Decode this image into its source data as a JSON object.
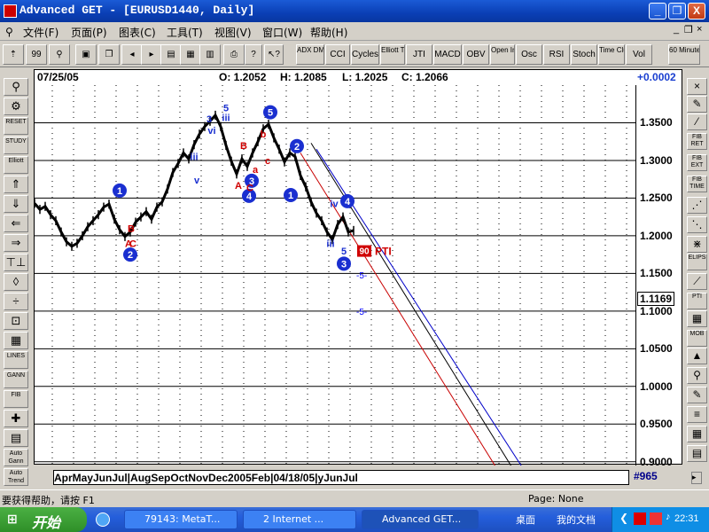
{
  "window": {
    "title": "Advanced GET - [EURUSD1440, Daily]",
    "buttons": [
      "_",
      "❐",
      "X"
    ]
  },
  "menu": [
    "文件(F)",
    "页面(P)",
    "图表(C)",
    "工具(T)",
    "视图(V)",
    "窗口(W)",
    "帮助(H)"
  ],
  "toolbar": {
    "indicators": [
      "ADX DMI",
      "CCI",
      "Cycles",
      "Elliott Trig",
      "JTI",
      "MACD",
      "OBV",
      "Open Int",
      "Osc",
      "RSI",
      "Stoch",
      "Time Clust",
      "Vol",
      "60 Minute"
    ]
  },
  "left_tools": [
    "",
    "",
    "RESET",
    "STUDY",
    "Elliott",
    "",
    "",
    "",
    "",
    "",
    "",
    "",
    "",
    "",
    "LINES",
    "GANN",
    "FIB",
    "",
    "",
    "Auto Gann",
    "Auto Trend"
  ],
  "right_tools": [
    "",
    "",
    "",
    "FIB RET",
    "FIB EXT",
    "FIB TIME",
    "",
    "",
    "",
    "ELIPS",
    "",
    "PTI",
    "",
    "MOB",
    "",
    "",
    "",
    "",
    "",
    ""
  ],
  "infobar": {
    "date": "07/25/05",
    "open": "O: 1.2052",
    "high": "H: 1.2085",
    "low": "L: 1.2025",
    "close": "C: 1.2066",
    "change": "+0.0002"
  },
  "price_axis": {
    "ticks": [
      "1.3500",
      "1.3000",
      "1.2500",
      "1.2000",
      "1.1500",
      "1.1169",
      "1.1000",
      "1.0500",
      "1.0000",
      "0.9500",
      "0.9000"
    ],
    "current": "1.1169"
  },
  "chart_data": {
    "type": "line",
    "instrument": "EURUSD1440",
    "period": "Daily",
    "ylim": [
      0.9,
      1.4
    ],
    "yticks": [
      1.35,
      1.3,
      1.25,
      1.2,
      1.15,
      1.1,
      1.05,
      1.0,
      0.95,
      0.9
    ],
    "x": [
      0,
      6,
      12,
      18,
      24,
      30,
      36,
      42,
      48,
      54,
      60,
      66,
      72,
      78,
      84,
      90,
      96,
      102,
      108,
      114,
      120,
      126,
      132,
      138,
      144,
      150,
      156,
      162,
      168,
      174,
      180,
      186,
      192,
      198,
      204,
      210,
      216,
      222,
      228,
      234,
      240,
      246,
      252,
      258,
      264,
      270,
      276,
      282,
      288,
      294,
      300,
      306,
      312,
      318,
      324,
      330,
      336,
      342,
      348,
      354,
      360
    ],
    "close": [
      1.243,
      1.235,
      1.239,
      1.228,
      1.22,
      1.205,
      1.192,
      1.186,
      1.19,
      1.2,
      1.212,
      1.22,
      1.228,
      1.238,
      1.242,
      1.222,
      1.208,
      1.199,
      1.205,
      1.218,
      1.225,
      1.232,
      1.222,
      1.238,
      1.245,
      1.262,
      1.284,
      1.296,
      1.31,
      1.302,
      1.321,
      1.335,
      1.345,
      1.352,
      1.36,
      1.345,
      1.32,
      1.299,
      1.282,
      1.302,
      1.292,
      1.31,
      1.325,
      1.342,
      1.348,
      1.33,
      1.315,
      1.298,
      1.31,
      1.305,
      1.28,
      1.265,
      1.245,
      1.23,
      1.22,
      1.205,
      1.195,
      1.215,
      1.225,
      1.205,
      1.207
    ],
    "channel_lines": [
      {
        "color": "#0000c8",
        "from": [
          318,
          1.315
        ],
        "to": [
          560,
          0.875
        ]
      },
      {
        "color": "#000000",
        "from": [
          312,
          1.323
        ],
        "to": [
          548,
          0.875
        ]
      },
      {
        "color": "#c80000",
        "from": [
          300,
          1.31
        ],
        "to": [
          530,
          0.875
        ]
      }
    ],
    "labels": [
      {
        "text": "1",
        "color": "blue",
        "x": 96,
        "y": 1.26,
        "circled": true
      },
      {
        "text": "2",
        "color": "blue",
        "x": 108,
        "y": 1.175,
        "circled": true
      },
      {
        "text": "3",
        "color": "blue",
        "x": 245,
        "y": 1.273,
        "circled": true
      },
      {
        "text": "4",
        "color": "blue",
        "x": 242,
        "y": 1.253,
        "circled": true
      },
      {
        "text": "5",
        "color": "blue",
        "x": 266,
        "y": 1.364,
        "circled": true
      },
      {
        "text": "2",
        "color": "blue",
        "x": 296,
        "y": 1.319,
        "circled": true
      },
      {
        "text": "1",
        "color": "blue",
        "x": 289,
        "y": 1.254,
        "circled": true
      },
      {
        "text": "4",
        "color": "blue",
        "x": 353,
        "y": 1.246,
        "circled": true
      },
      {
        "text": "3",
        "color": "blue",
        "x": 349,
        "y": 1.163,
        "circled": true
      },
      {
        "text": "5",
        "color": "blue",
        "x": 216,
        "y": 1.37,
        "circled": false
      },
      {
        "text": "iii",
        "color": "blue",
        "x": 216,
        "y": 1.357,
        "circled": false
      },
      {
        "text": "3",
        "color": "blue",
        "x": 197,
        "y": 1.355,
        "circled": false
      },
      {
        "text": "vi",
        "color": "blue",
        "x": 200,
        "y": 1.34,
        "circled": false
      },
      {
        "text": "iii",
        "color": "blue",
        "x": 180,
        "y": 1.305,
        "circled": false
      },
      {
        "text": "v",
        "color": "blue",
        "x": 183,
        "y": 1.274,
        "circled": false
      },
      {
        "text": "B",
        "color": "red",
        "x": 236,
        "y": 1.32,
        "circled": false
      },
      {
        "text": "b",
        "color": "red",
        "x": 258,
        "y": 1.335,
        "circled": false
      },
      {
        "text": "a",
        "color": "red",
        "x": 249,
        "y": 1.288,
        "circled": false
      },
      {
        "text": "c",
        "color": "red",
        "x": 263,
        "y": 1.3,
        "circled": false
      },
      {
        "text": "A",
        "color": "red",
        "x": 230,
        "y": 1.267,
        "circled": false
      },
      {
        "text": "C",
        "color": "red",
        "x": 243,
        "y": 1.264,
        "circled": false
      },
      {
        "text": "A",
        "color": "red",
        "x": 106,
        "y": 1.19,
        "circled": false
      },
      {
        "text": "B",
        "color": "red",
        "x": 109,
        "y": 1.21,
        "circled": false
      },
      {
        "text": "C",
        "color": "red",
        "x": 111,
        "y": 1.19,
        "circled": false
      },
      {
        "text": "iv",
        "color": "blue",
        "x": 338,
        "y": 1.243,
        "circled": false
      },
      {
        "text": "iii",
        "color": "blue",
        "x": 334,
        "y": 1.19,
        "circled": false
      },
      {
        "text": "5",
        "color": "blue",
        "x": 349,
        "y": 1.18,
        "circled": false
      }
    ],
    "annotations": [
      {
        "text": "90",
        "color": "#ffffff",
        "bg": "#d00000"
      },
      {
        "text": "PTI",
        "color": "#d00000"
      },
      {
        "text": "-5-",
        "color": "blue"
      },
      {
        "text": "-5-",
        "color": "blue"
      }
    ]
  },
  "date_axis": [
    "Apr",
    "May",
    "Jun",
    "Jul",
    "Aug",
    "Sep",
    "Oct",
    "Nov",
    "Dec",
    "2005",
    "Feb",
    "04/18/05",
    "y",
    "Jun",
    "Jul"
  ],
  "date_axis_text": "AprMayJunJul|AugSepOctNovDec2005Feb|04/18/05|yJunJul",
  "bar_number": "#965",
  "status": {
    "help": "要获得帮助，请按 F1",
    "page": "Page: None"
  },
  "taskbar": {
    "start": "开始",
    "tasks": [
      "79143: MetaT...",
      "2 Internet ...",
      "Advanced GET..."
    ],
    "desktop": "桌面",
    "mydocs": "我的文档",
    "clock": "22:31"
  }
}
